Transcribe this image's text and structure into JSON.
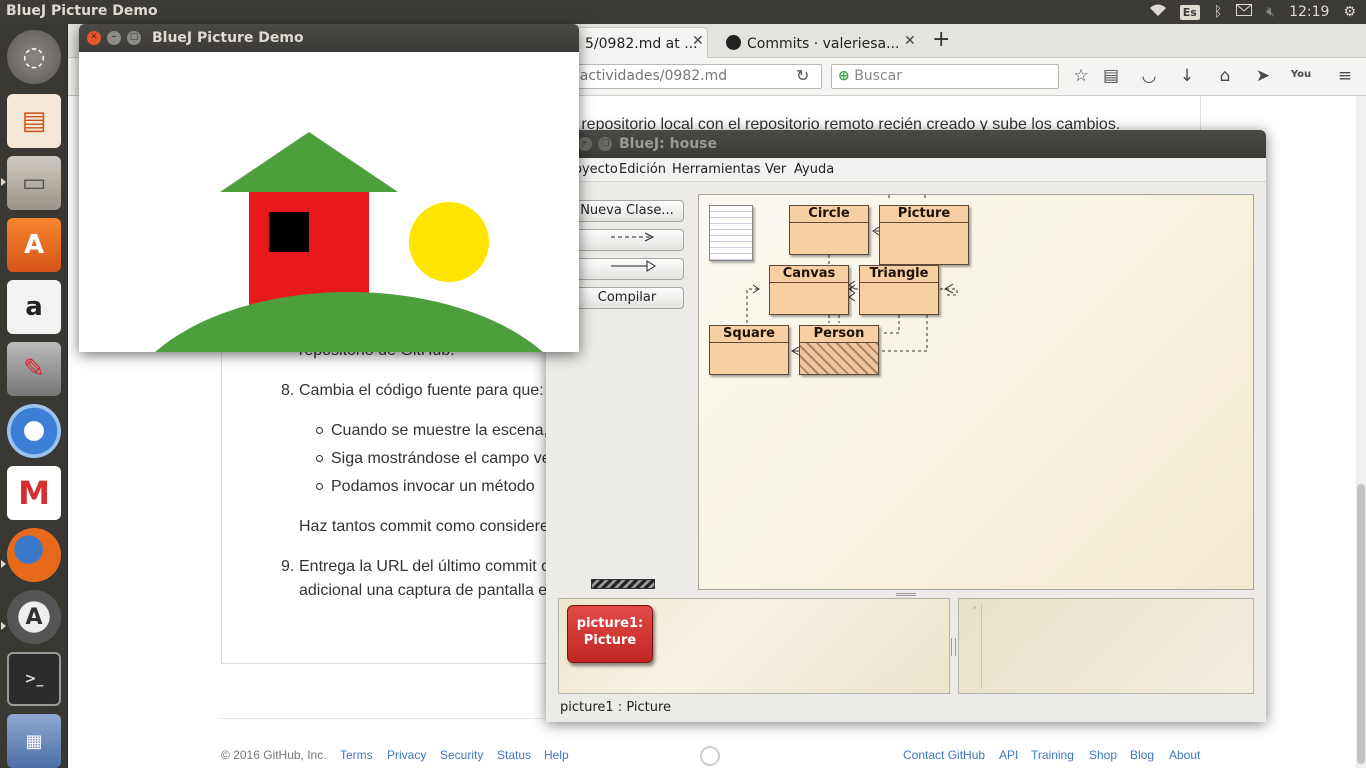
{
  "topbar": {
    "title": "BlueJ Picture Demo",
    "keyboard": "Es",
    "clock": "12:19"
  },
  "launcher": {
    "items": [
      "dash-home",
      "impress",
      "files",
      "software-center",
      "amazon",
      "system-settings",
      "chromium",
      "gmail",
      "firefox",
      "software-updater",
      "terminal",
      "workspaces"
    ]
  },
  "firefox": {
    "tabs": [
      {
        "label": "5/0982.md at ..."
      },
      {
        "label": "Commits · valeriesa..."
      }
    ],
    "new_tab": "+",
    "url": "/actividades/0982.md",
    "search_placeholder": "Buscar"
  },
  "document": {
    "line_top": "u repositorio local con el repositorio remoto recién creado y sube los cambios.",
    "line_repo": "repositorio de GitHub.",
    "item8_num": "8.",
    "item8_text": "Cambia el código fuente para que:",
    "sub1": "Cuando se muestre la escena,",
    "sub2": "Siga mostrándose el campo ve",
    "sub3": "Podamos invocar un método",
    "commit_text": "Haz tantos commit como considere",
    "item9_num": "9.",
    "item9_line1": "Entrega la URL del último commit c",
    "item9_line2": "adicional una captura de pantalla e"
  },
  "footer": {
    "copyright": "© 2016 GitHub, Inc.",
    "left_links": [
      "Terms",
      "Privacy",
      "Security",
      "Status",
      "Help"
    ],
    "right_links": [
      "Contact GitHub",
      "API",
      "Training",
      "Shop",
      "Blog",
      "About"
    ]
  },
  "bluej": {
    "title": "BlueJ:  house",
    "menu": [
      "oyecto",
      "Edición",
      "Herramientas",
      "Ver",
      "Ayuda"
    ],
    "buttons": {
      "new_class": "Nueva Clase...",
      "compile": "Compilar"
    },
    "classes": [
      "Circle",
      "Picture",
      "Canvas",
      "Triangle",
      "Square",
      "Person"
    ],
    "object": {
      "name": "picture1:",
      "type": "Picture"
    },
    "status": "picture1 : Picture"
  },
  "picture_window": {
    "title": "BlueJ Picture Demo",
    "colors": {
      "sky": "#ffffff",
      "wall": "#e8191c",
      "window": "#000000",
      "roof": "#4d9e3c",
      "sun": "#ffe400",
      "hill": "#4d9e3c"
    }
  }
}
